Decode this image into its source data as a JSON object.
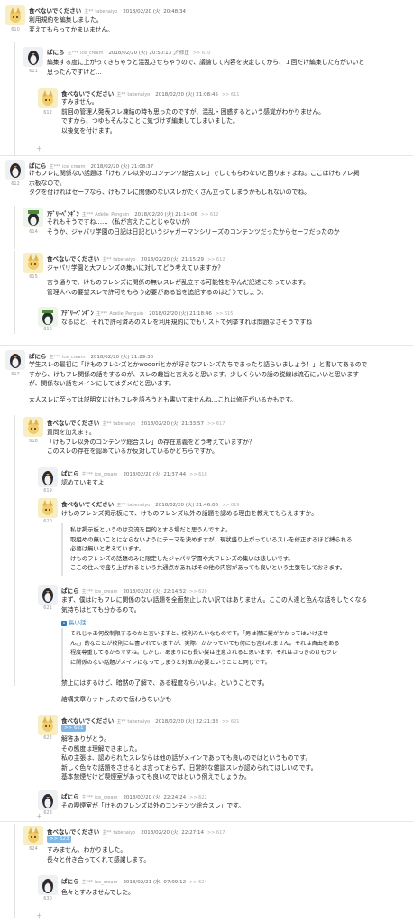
{
  "posts": [
    {
      "num": "610",
      "name": "食べないでください",
      "uid": "tabenaiyo",
      "date": "2018/02/20 (火) 20:48:34",
      "reply": "",
      "body": "利用規約を編集しました。\n変えてもらってかまいません。",
      "avatar": "serval"
    },
    {
      "num": "611",
      "name": "ぱにら",
      "uid": "ice_cream",
      "date": "2018/02/20 (火) 20:50:13 🖊修正",
      "reply": ">> 610",
      "body": "編集する度に上がってきちゃうと混乱させちゃうので、議論して内容を決定してから、１回だけ編集した方がいいと\n思ったんですけど…",
      "avatar": "penguin_dark"
    },
    {
      "num": "612",
      "name": "食べないでください",
      "uid": "tabenaiyo",
      "date": "2018/02/20 (火) 21:08:45",
      "reply": ">> 611",
      "body": "すみません。\n前回の管理人発表スレ凍結の時も思ったのですが、混乱・困惑するという感覚がわかりません。\nですから、つゆもそんなことに気づけず編集してしまいました。\n以後気を付けます。",
      "avatar": "serval"
    },
    {
      "num": "612",
      "name": "ぱにら",
      "uid": "ice_cream",
      "date": "2018/02/20 (火) 21:08:37",
      "reply": "",
      "body": "けもフレに関係ない話題は「けもフレ以外のコンテンツ総合スレ」でしてもらわないと困りますよね。ここはけもフレ掲\n示板なので。\nタグを付ければセーフなら、けもフレに関係のないスレがたくさん立ってしまうかもしれないのでね。",
      "avatar": "penguin_dark"
    },
    {
      "num": "614",
      "name": "ｱﾃﾞﾘｰﾍﾟﾝｷﾞﾝ",
      "uid": "Adelie_Penguin",
      "date": "2018/02/20 (火) 21:14:06",
      "reply": ">> 612",
      "body": "それもそうですね……（私が言えたことじゃないが）\nそうか、ジャパリ学園の日記は日記というジャガーマンシリーズのコンテンツだったからセーフだったのか",
      "avatar": "penguin_green"
    },
    {
      "num": "615",
      "name": "食べないでください",
      "uid": "tabenaiyo",
      "date": "2018/02/20 (火) 21:15:29",
      "reply": ">> 612",
      "body": "ジャパリ学園と大フレンズの集いに対してどう考えていますか？",
      "avatar": "serval"
    },
    {
      "num": "616",
      "name": "ｱﾃﾞﾘｰﾍﾟﾝｷﾞﾝ",
      "uid": "Adelie_Penguin",
      "date": "2018/02/20 (火) 21:18:46",
      "reply": ">> 615",
      "body": "なるほど、それで許可済みのスレを利用規約にでもリストで列挙すれば問題なさそうですね",
      "avatar": "penguin_green"
    },
    {
      "num": "617",
      "name": "ぱにら",
      "uid": "ice_cream",
      "date": "2018/02/20 (火) 21:29:30",
      "reply": "",
      "body": "学生スレの最初に「けものフレンズとかwodoriとかが好きなフレンズたちでまったり語らいましょう！」と書いてあるので\nすから、けもフレ関係の話をするのが、スレの趣旨と言えると思います。少しくらいの話の脱線は流石にいいと思います\nが、関係ない話をメインにしてはダメだと思います。",
      "avatar": "penguin_dark"
    },
    {
      "num": "618",
      "name": "食べないでください",
      "uid": "tabenaiyo",
      "date": "2018/02/20 (火) 21:33:57",
      "reply": ">> 617",
      "body": "質問を加えます。\n「けもフレ以外のコンテンツ総合スレ」の存在意義をどう考えていますか？\nこのスレの存在を認めているか反対しているかどちらですか。",
      "avatar": "serval"
    },
    {
      "num": "619",
      "name": "ぱにら",
      "uid": "ice_cream",
      "date": "2018/02/20 (火) 21:37:44",
      "reply": ">> 618",
      "body": "認めていますよ",
      "avatar": "penguin_dark"
    },
    {
      "num": "620",
      "name": "食べないでください",
      "uid": "tabenaiyo",
      "date": "2018/02/20 (火) 21:46:06",
      "reply": ">> 619",
      "body": "けものフレンズ掲示板にて、けものフレンズ以外の話題を認める理由を教えてもらえますか。",
      "avatar": "serval"
    },
    {
      "num": "621",
      "name": "ぱにら",
      "uid": "ice_cream",
      "date": "2018/02/20 (火) 22:14:52",
      "reply": ">> 620",
      "body": "まず、僕はけもフレに関係のない話題を全面禁止したい訳ではありません。ここの人達と色んな話をしたくなる\n気持ちはとても分かるので。",
      "avatar": "penguin_dark"
    },
    {
      "num": "622",
      "name": "食べないでください",
      "uid": "tabenaiyo",
      "date": "2018/02/20 (火) 22:21:38",
      "reply": ">> 621",
      "body": "解答ありがとう。\nその態度は理解できました。\n私の主張は、認められたスレならは他の話がメインであっても良いのではというものです。\n新しく色々な話題をさせるとは言っておらず、日常的な雑談スレが認められてほしいのです。\n基本禁煙だけど喫煙室があっても良いのではという例えでしょうか。",
      "avatar": "serval"
    },
    {
      "num": "623",
      "name": "ぱにら",
      "uid": "ice_cream",
      "date": "2018/02/20 (火) 22:24:24",
      "reply": ">> 622",
      "body": "その喫煙室が「けものフレンズ以外のコンテンツ総合スレ」です。",
      "avatar": "penguin_dark"
    },
    {
      "num": "624",
      "name": "食べないでください",
      "uid": "tabenaiyo",
      "date": "2018/02/20 (火) 22:27:14",
      "reply": ">> 617",
      "body": "すみません、わかりました。\n長々と付き合ってくれて感謝します。",
      "avatar": "serval"
    },
    {
      "num": "630",
      "name": "ぱにら",
      "uid": "ice_cream",
      "date": "2018/02/21 (水) 07:09:12",
      "reply": ">> 624",
      "body": "色々とすみませんでした。",
      "avatar": "penguin_dark"
    }
  ],
  "extras": {
    "p615_more": "言う通りで、けものフレンズに関係の無いスレが乱立する可能性を孕んだ記述になっています。\n管理人への要望スレで許可をもらう必要がある旨を追記するのはどうでしょう。",
    "p617_more": "大人スレに至っては説明文にけもフレを語ろうとも書いてませんね…これは修正がいるかもです。",
    "p620_more": "私は掲示板というのは交流を目的とする場だと思うんですよ。\n取組めの無いことにならないようにテーマを決めますが、現状盛り上がっているスレを修正するほど縛られる\n必要は無いと考えています。\nけものフレンズの話題のみに限定したジャパリ学園や大フレンズの集いは悲しいです。\nここの住人で盛り上げれるという共通点があればその他の内容があっても良いという主張をしておきます。",
    "p621_toggle": "長い話",
    "p621_quote": "それじゃあ何故制限するのかと言いますと、校則みたいなものです。「男は襟に髪がかかってはいけませ\nん。」的なことが校則には書かれていますが、実際、かかっていても何にも言われません。それは自由をある\n程度尊重してるからですね。しかし、あまりにも長い髪は注意されると思います。それはさっきのけもフレ\nに関係のない話題がメインになってしまうと対策が必要ということと同じです。",
    "p621_quote2": "禁止にはするけど、暗黙の了解で、ある程度ならいいよ。ということです。",
    "p621_quote3": "結構文章カットしたので伝わらないかも",
    "badge_621": ">> 621",
    "badge_623": ">> 623"
  }
}
